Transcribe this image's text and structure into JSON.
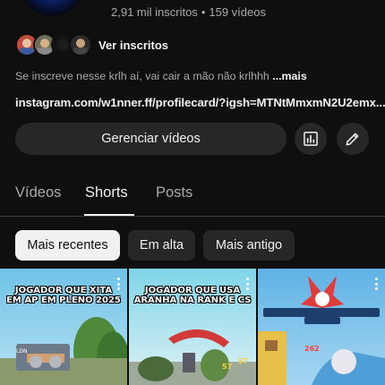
{
  "channel": {
    "stats": {
      "subscribers": "2,91 mil inscritos",
      "separator": "•",
      "videos": "159 vídeos"
    },
    "subscribers_link": "Ver inscritos",
    "description": "Se inscreve nesse krlh aí, vai cair a mão não krlhhh ",
    "description_more": "...mais",
    "link": "instagram.com/w1nner.ff/profilecard/?igsh=MTNtMmxmN2U2emx..."
  },
  "actions": {
    "manage_label": "Gerenciar vídeos",
    "analytics_icon": "analytics-icon",
    "edit_icon": "pencil-icon"
  },
  "tabs": [
    {
      "label": "Vídeos",
      "active": false
    },
    {
      "label": "Shorts",
      "active": true
    },
    {
      "label": "Posts",
      "active": false
    }
  ],
  "filters": [
    {
      "label": "Mais recentes",
      "selected": true
    },
    {
      "label": "Em alta",
      "selected": false
    },
    {
      "label": "Mais antigo",
      "selected": false
    }
  ],
  "shorts": [
    {
      "caption_line1": "JOGADOR QUE XITA",
      "caption_line2": "EM AP EM PLENO 2025"
    },
    {
      "caption_line1": "JOGADOR QUE USA",
      "caption_line2": "ARANHA NA RANK E CS"
    },
    {
      "caption_line1": "",
      "caption_line2": ""
    }
  ],
  "colors": {
    "background": "#0f0f0f",
    "surface": "#272727",
    "text": "#f1f1f1",
    "muted": "#aaaaaa"
  }
}
